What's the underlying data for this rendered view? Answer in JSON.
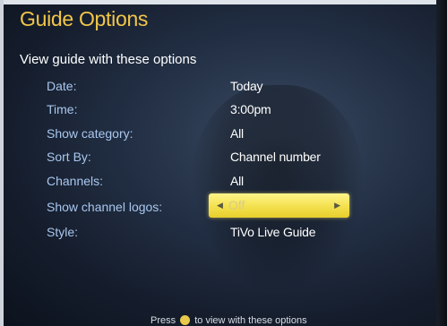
{
  "screen": {
    "title": "Guide Options",
    "subtitle": "View guide with these options"
  },
  "options": [
    {
      "label": "Date:",
      "value": "Today"
    },
    {
      "label": "Time:",
      "value": "3:00pm"
    },
    {
      "label": "Show category:",
      "value": "All"
    },
    {
      "label": "Sort By:",
      "value": "Channel number"
    },
    {
      "label": "Channels:",
      "value": "All"
    },
    {
      "label": "Show channel logos:",
      "value": "Off",
      "selected": true
    },
    {
      "label": "Style:",
      "value": "TiVo Live Guide"
    }
  ],
  "footer": {
    "prefix": "Press",
    "suffix": "to view with these options",
    "button_icon": "select-button-icon"
  },
  "colors": {
    "title": "#f2c64a",
    "label": "#a9c7ee",
    "value": "#ffffff",
    "highlight": "#f3e04e"
  }
}
